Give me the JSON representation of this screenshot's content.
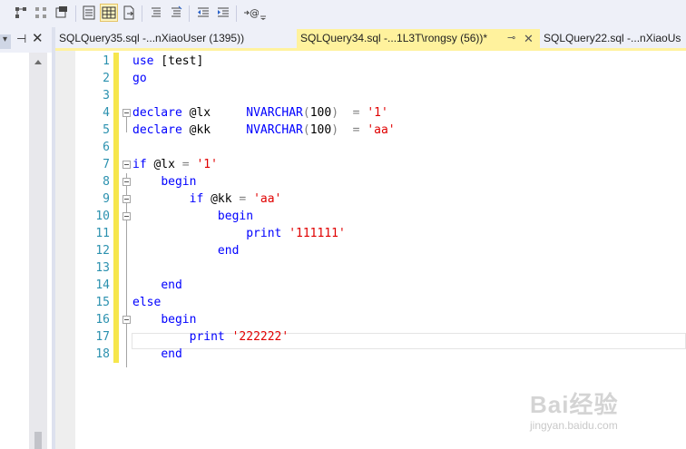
{
  "tabs": [
    {
      "label": "SQLQuery35.sql -...nXiaoUser (1395))",
      "active": false
    },
    {
      "label": "SQLQuery34.sql -...1L3T\\rongsy (56))*",
      "active": true
    },
    {
      "label": "SQLQuery22.sql -...nXiaoUs",
      "active": false
    }
  ],
  "code_lines": [
    {
      "num": "1",
      "text": "use [test]"
    },
    {
      "num": "2",
      "text": "go"
    },
    {
      "num": "3",
      "text": ""
    },
    {
      "num": "4",
      "text": "declare @lx     NVARCHAR(100)  = '1'"
    },
    {
      "num": "5",
      "text": "declare @kk     NVARCHAR(100)  = 'aa'"
    },
    {
      "num": "6",
      "text": ""
    },
    {
      "num": "7",
      "text": "if @lx = '1'"
    },
    {
      "num": "8",
      "text": "    begin"
    },
    {
      "num": "9",
      "text": "        if @kk = 'aa'"
    },
    {
      "num": "10",
      "text": "            begin"
    },
    {
      "num": "11",
      "text": "                print '111111'"
    },
    {
      "num": "12",
      "text": "            end"
    },
    {
      "num": "13",
      "text": ""
    },
    {
      "num": "14",
      "text": "    end"
    },
    {
      "num": "15",
      "text": "else"
    },
    {
      "num": "16",
      "text": "    begin"
    },
    {
      "num": "17",
      "text": "        print '222222'"
    },
    {
      "num": "18",
      "text": "    end"
    }
  ],
  "watermark": {
    "brand": "Bai经验",
    "url": "jingyan.baidu.com"
  },
  "colors": {
    "keyword": "#0000ff",
    "string": "#e00000",
    "line_number": "#2b91af",
    "change_marker": "#f6e64c",
    "active_tab": "#fff29d"
  }
}
